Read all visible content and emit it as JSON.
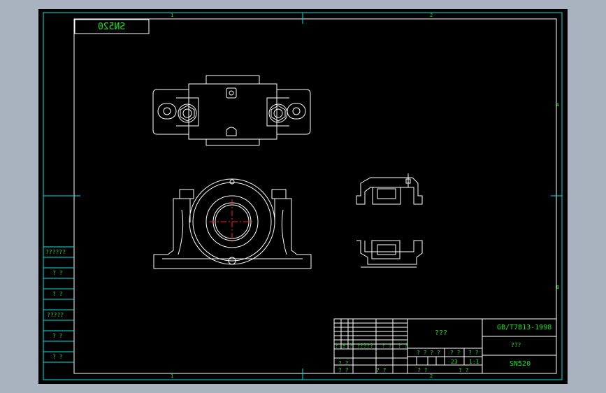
{
  "drawing": {
    "mirrored_tag": "SN520",
    "zone_top_1": "1",
    "zone_top_2": "2",
    "zone_bottom_1": "1",
    "zone_bottom_2": "2",
    "zone_right_a": "A",
    "zone_right_b": "B"
  },
  "left_table": {
    "rows": [
      "??????",
      "? ?",
      "? ?",
      "?????",
      "? ?",
      "? ?"
    ]
  },
  "title_block": {
    "center_title": "???",
    "standard": "GB/T7813-1998",
    "company": "???",
    "part_number": "SN520",
    "sig_row": [
      "? ?",
      "? ?",
      "?????",
      "? ?",
      "? ?"
    ],
    "left_cells": [
      "? ?",
      "? ?",
      "? ?"
    ],
    "stage_header": "? ? ? ?",
    "stage_label": "? ?",
    "scale_label": "? ?",
    "weight_value": "23",
    "scale_value": "1:1",
    "sheet_labels": [
      "? ?",
      "? ?"
    ]
  },
  "colors": {
    "background": "#000000",
    "frame": "#00e5e5",
    "outline": "#ffffff",
    "text": "#19e619",
    "centerline": "#ff2020"
  }
}
